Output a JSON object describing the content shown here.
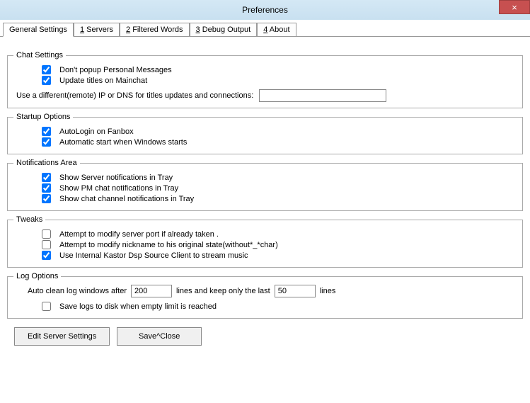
{
  "window": {
    "title": "Preferences",
    "close": "×"
  },
  "tabs": {
    "general": "General Settings",
    "servers_prefix": "1",
    "servers": " Servers",
    "filtered_prefix": "2",
    "filtered": " Filtered Words",
    "debug_prefix": "3",
    "debug": " Debug Output",
    "about_prefix": "4",
    "about": " About"
  },
  "chat": {
    "legend": "Chat Settings",
    "no_popup": "Don't popup Personal Messages",
    "update_titles": "Update titles on Mainchat",
    "ip_label": "Use a different(remote) IP or DNS  for titles updates and connections:",
    "ip_value": ""
  },
  "startup": {
    "legend": "Startup Options",
    "autologin": "AutoLogin on Fanbox",
    "autostart": "Automatic start when Windows starts"
  },
  "notify": {
    "legend": "Notifications Area",
    "server": "Show Server notifications in Tray",
    "pm": "Show PM chat notifications in Tray",
    "channel": "Show chat channel notifications in Tray"
  },
  "tweaks": {
    "legend": "Tweaks",
    "port": "Attempt to modify server  port if already taken .",
    "nick": "Attempt to modify nickname to his original  state(without*_*char)",
    "dsp": "Use Internal Kastor Dsp Source Client to stream music"
  },
  "log": {
    "legend": "Log Options",
    "auto_clean_1": "Auto clean log windows after",
    "auto_clean_val1": "200",
    "auto_clean_2": "lines  and keep only the last",
    "auto_clean_val2": "50",
    "auto_clean_3": "lines",
    "save_disk": "Save logs to disk when empty limit is reached"
  },
  "buttons": {
    "edit_server": "Edit Server Settings",
    "save_close": "Save^Close"
  }
}
